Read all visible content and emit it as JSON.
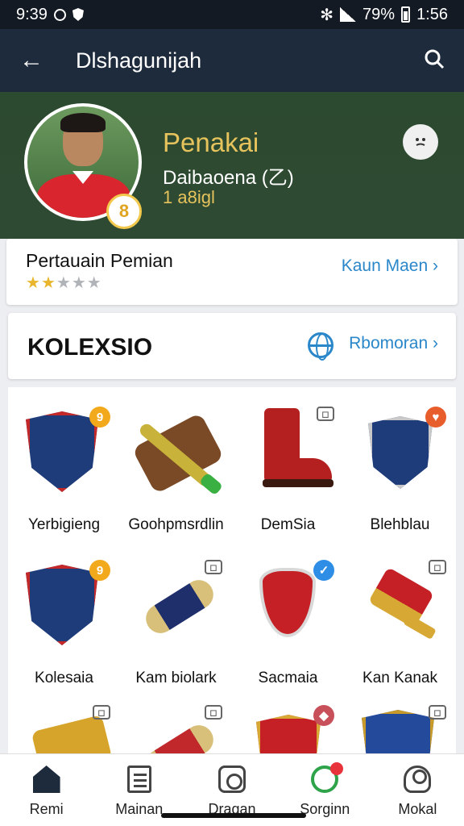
{
  "statusbar": {
    "time_left": "9:39",
    "battery_text": "79%",
    "time_right": "1:56"
  },
  "appbar": {
    "title": "Dlshagunijah"
  },
  "profile": {
    "name": "Penakai",
    "subtitle": "Daibaoena (乙)",
    "number": "1 a8igl",
    "level_badge": "8"
  },
  "stats": {
    "label": "Pertauain Pemian",
    "rating": 2,
    "rating_max": 5,
    "link": "Kaun Maen"
  },
  "collection": {
    "title": "KOLEXSIO",
    "link": "Rbomoran"
  },
  "items": [
    {
      "name": "Yerbigieng",
      "corner": "9",
      "corner_style": "gold",
      "icon": "crest-icon"
    },
    {
      "name": "Goohpmsrdlin",
      "corner": "",
      "corner_style": "none",
      "icon": "case-icon"
    },
    {
      "name": "DemSia",
      "corner": "◻",
      "corner_style": "grey",
      "icon": "boot-icon"
    },
    {
      "name": "Blehblau",
      "corner": "♥",
      "corner_style": "orange",
      "icon": "shield-icon"
    },
    {
      "name": "Kolesaia",
      "corner": "9",
      "corner_style": "gold",
      "icon": "crest-icon"
    },
    {
      "name": "Kam biolark",
      "corner": "◻",
      "corner_style": "grey",
      "icon": "tube-icon"
    },
    {
      "name": "Sacmaia",
      "corner": "✓",
      "corner_style": "blue",
      "icon": "shield-icon"
    },
    {
      "name": "Kan Kanak",
      "corner": "◻",
      "corner_style": "grey",
      "icon": "cup-icon"
    },
    {
      "name": "",
      "corner": "◻",
      "corner_style": "grey",
      "icon": "barrel-icon"
    },
    {
      "name": "",
      "corner": "◻",
      "corner_style": "grey",
      "icon": "tube-icon"
    },
    {
      "name": "",
      "corner": "◆",
      "corner_style": "rose",
      "icon": "shield-icon"
    },
    {
      "name": "",
      "corner": "◻",
      "corner_style": "grey",
      "icon": "crest-icon"
    }
  ],
  "bottomnav": [
    {
      "label": "Remi",
      "icon": "home-icon"
    },
    {
      "label": "Mainan",
      "icon": "document-icon"
    },
    {
      "label": "Dragan",
      "icon": "camera-icon"
    },
    {
      "label": "Sorginn",
      "icon": "chat-icon"
    },
    {
      "label": "Mokal",
      "icon": "user-icon"
    }
  ],
  "colors": {
    "appbar": "#1e2b3c",
    "header": "#2c4a2f",
    "accent": "#2a87c9",
    "gold": "#e6c35c"
  }
}
